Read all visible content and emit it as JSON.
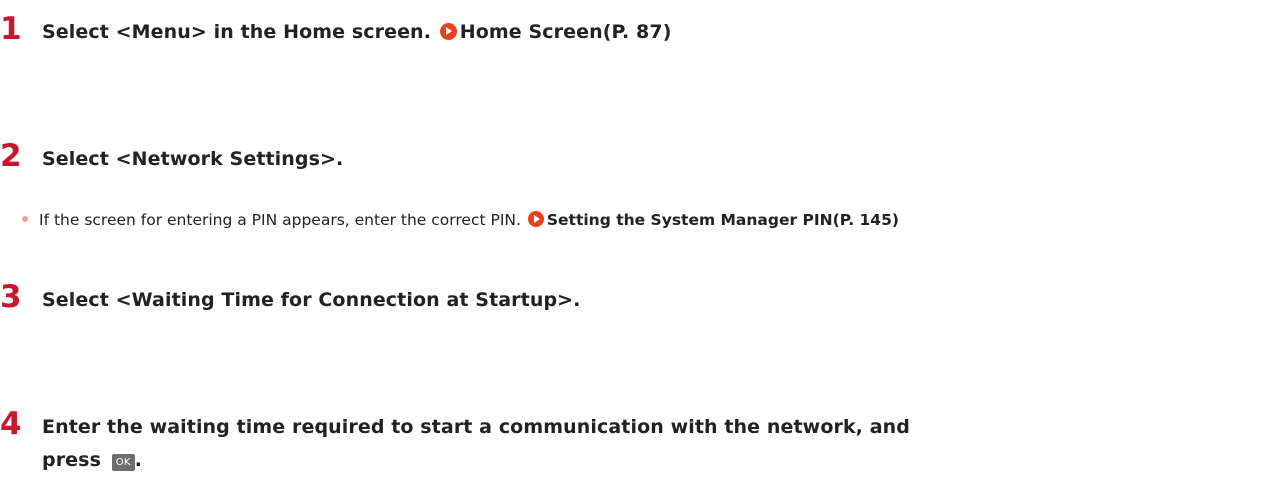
{
  "steps": [
    {
      "number": "1",
      "text": "Select <Menu> in the Home screen.",
      "link": "Home Screen(P. 87)"
    },
    {
      "number": "2",
      "text": "Select <Network Settings>."
    },
    {
      "number": "3",
      "text": "Select <Waiting Time for Connection at Startup>."
    },
    {
      "number": "4",
      "text": "Enter the waiting time required to start a communication with the network, and press",
      "key_label": "OK",
      "end": "."
    }
  ],
  "note": {
    "text": "If the screen for entering a PIN appears, enter the correct PIN.",
    "link": "Setting the System Manager PIN(P. 145)"
  },
  "colors": {
    "step_number": "#c9162c",
    "link_arrow": "#e8421b",
    "bullet": "#f0a58a",
    "key_bg": "#6e6e6e"
  }
}
